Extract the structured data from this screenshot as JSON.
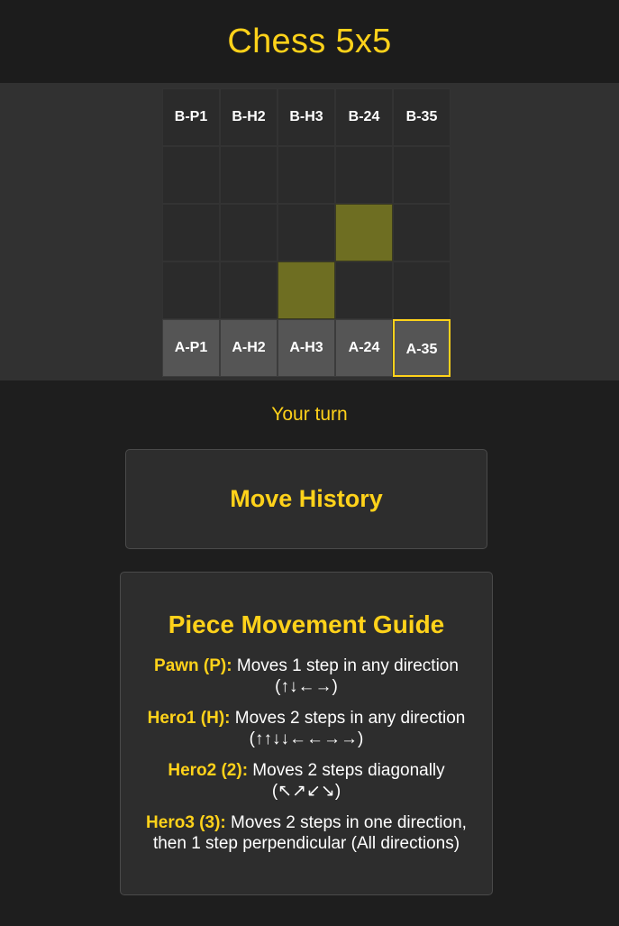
{
  "title": "Chess 5x5",
  "board": {
    "rows": [
      [
        {
          "label": "B-P1",
          "state": "piece-b"
        },
        {
          "label": "B-H2",
          "state": "piece-b"
        },
        {
          "label": "B-H3",
          "state": "piece-b"
        },
        {
          "label": "B-24",
          "state": "piece-b"
        },
        {
          "label": "B-35",
          "state": "piece-b"
        }
      ],
      [
        {
          "label": "",
          "state": "empty"
        },
        {
          "label": "",
          "state": "empty"
        },
        {
          "label": "",
          "state": "empty"
        },
        {
          "label": "",
          "state": "empty"
        },
        {
          "label": "",
          "state": "empty"
        }
      ],
      [
        {
          "label": "",
          "state": "empty"
        },
        {
          "label": "",
          "state": "empty"
        },
        {
          "label": "",
          "state": "empty"
        },
        {
          "label": "",
          "state": "highlight"
        },
        {
          "label": "",
          "state": "empty"
        }
      ],
      [
        {
          "label": "",
          "state": "empty"
        },
        {
          "label": "",
          "state": "empty"
        },
        {
          "label": "",
          "state": "highlight"
        },
        {
          "label": "",
          "state": "empty"
        },
        {
          "label": "",
          "state": "empty"
        }
      ],
      [
        {
          "label": "A-P1",
          "state": "piece-a"
        },
        {
          "label": "A-H2",
          "state": "piece-a"
        },
        {
          "label": "A-H3",
          "state": "piece-a"
        },
        {
          "label": "A-24",
          "state": "piece-a"
        },
        {
          "label": "A-35",
          "state": "selected"
        }
      ]
    ]
  },
  "status": "Your turn",
  "history": {
    "title": "Move History"
  },
  "guide": {
    "title": "Piece Movement Guide",
    "rules": [
      {
        "name": "Pawn (P):",
        "text": " Moves 1 step in any direction (↑↓←→)"
      },
      {
        "name": "Hero1 (H):",
        "text": " Moves 2 steps in any direction (↑↑↓↓←←→→)"
      },
      {
        "name": "Hero2 (2):",
        "text": " Moves 2 steps diagonally (↖↗↙↘)"
      },
      {
        "name": "Hero3 (3):",
        "text": " Moves 2 steps in one direction, then 1 step perpendicular (All directions)"
      }
    ]
  },
  "colors": {
    "accent": "#ffd21a",
    "highlight": "#6e6e22",
    "player_a_piece": "#555555",
    "background": "#1e1e1e"
  }
}
